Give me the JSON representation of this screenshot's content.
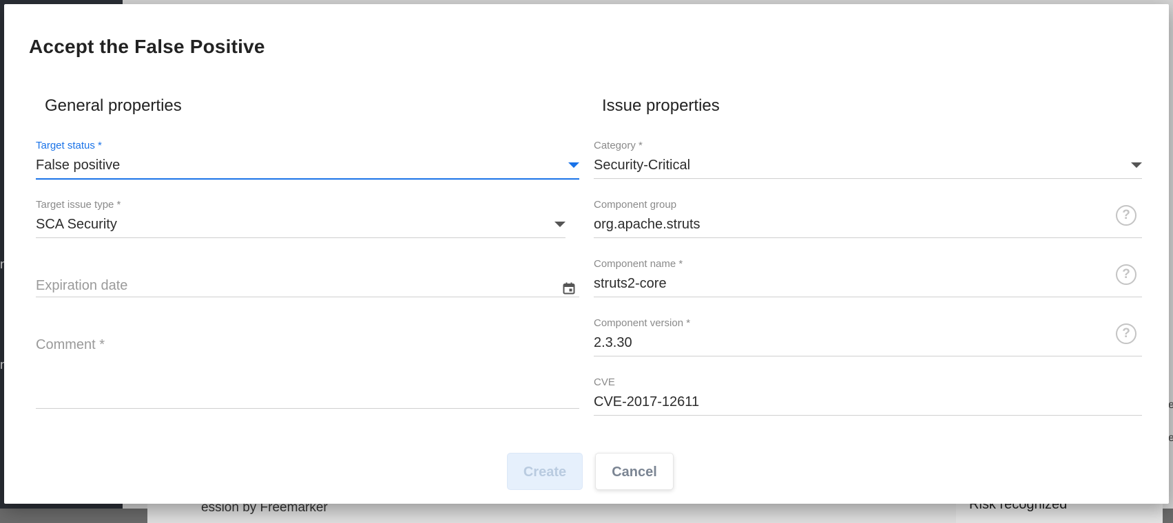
{
  "background": {
    "row_text": "ession by Freemarker",
    "right_card_text": "Risk recognized",
    "left_glyph_1": "n",
    "left_glyph_2": "n",
    "right_glyph_1": "e",
    "right_glyph_2": "e"
  },
  "dialog": {
    "title": "Accept the False Positive",
    "general": {
      "heading": "General properties",
      "target_status": {
        "label": "Target status *",
        "value": "False positive"
      },
      "target_issue_type": {
        "label": "Target issue type *",
        "value": "SCA Security"
      },
      "expiration_date": {
        "placeholder": "Expiration date"
      },
      "comment": {
        "placeholder": "Comment *"
      }
    },
    "issue": {
      "heading": "Issue properties",
      "category": {
        "label": "Category *",
        "value": "Security-Critical"
      },
      "component_group": {
        "label": "Component group",
        "value": "org.apache.struts"
      },
      "component_name": {
        "label": "Component name *",
        "value": "struts2-core"
      },
      "component_version": {
        "label": "Component version *",
        "value": "2.3.30"
      },
      "cve": {
        "label": "CVE",
        "value": "CVE-2017-12611"
      },
      "help_glyph": "?"
    },
    "buttons": {
      "create": "Create",
      "cancel": "Cancel"
    }
  },
  "colors": {
    "accent": "#1a73e8",
    "create_bg": "#e6f0fc",
    "title": "#222222"
  },
  "icons": [
    "chevron-down-icon",
    "help-icon",
    "calendar-icon"
  ]
}
